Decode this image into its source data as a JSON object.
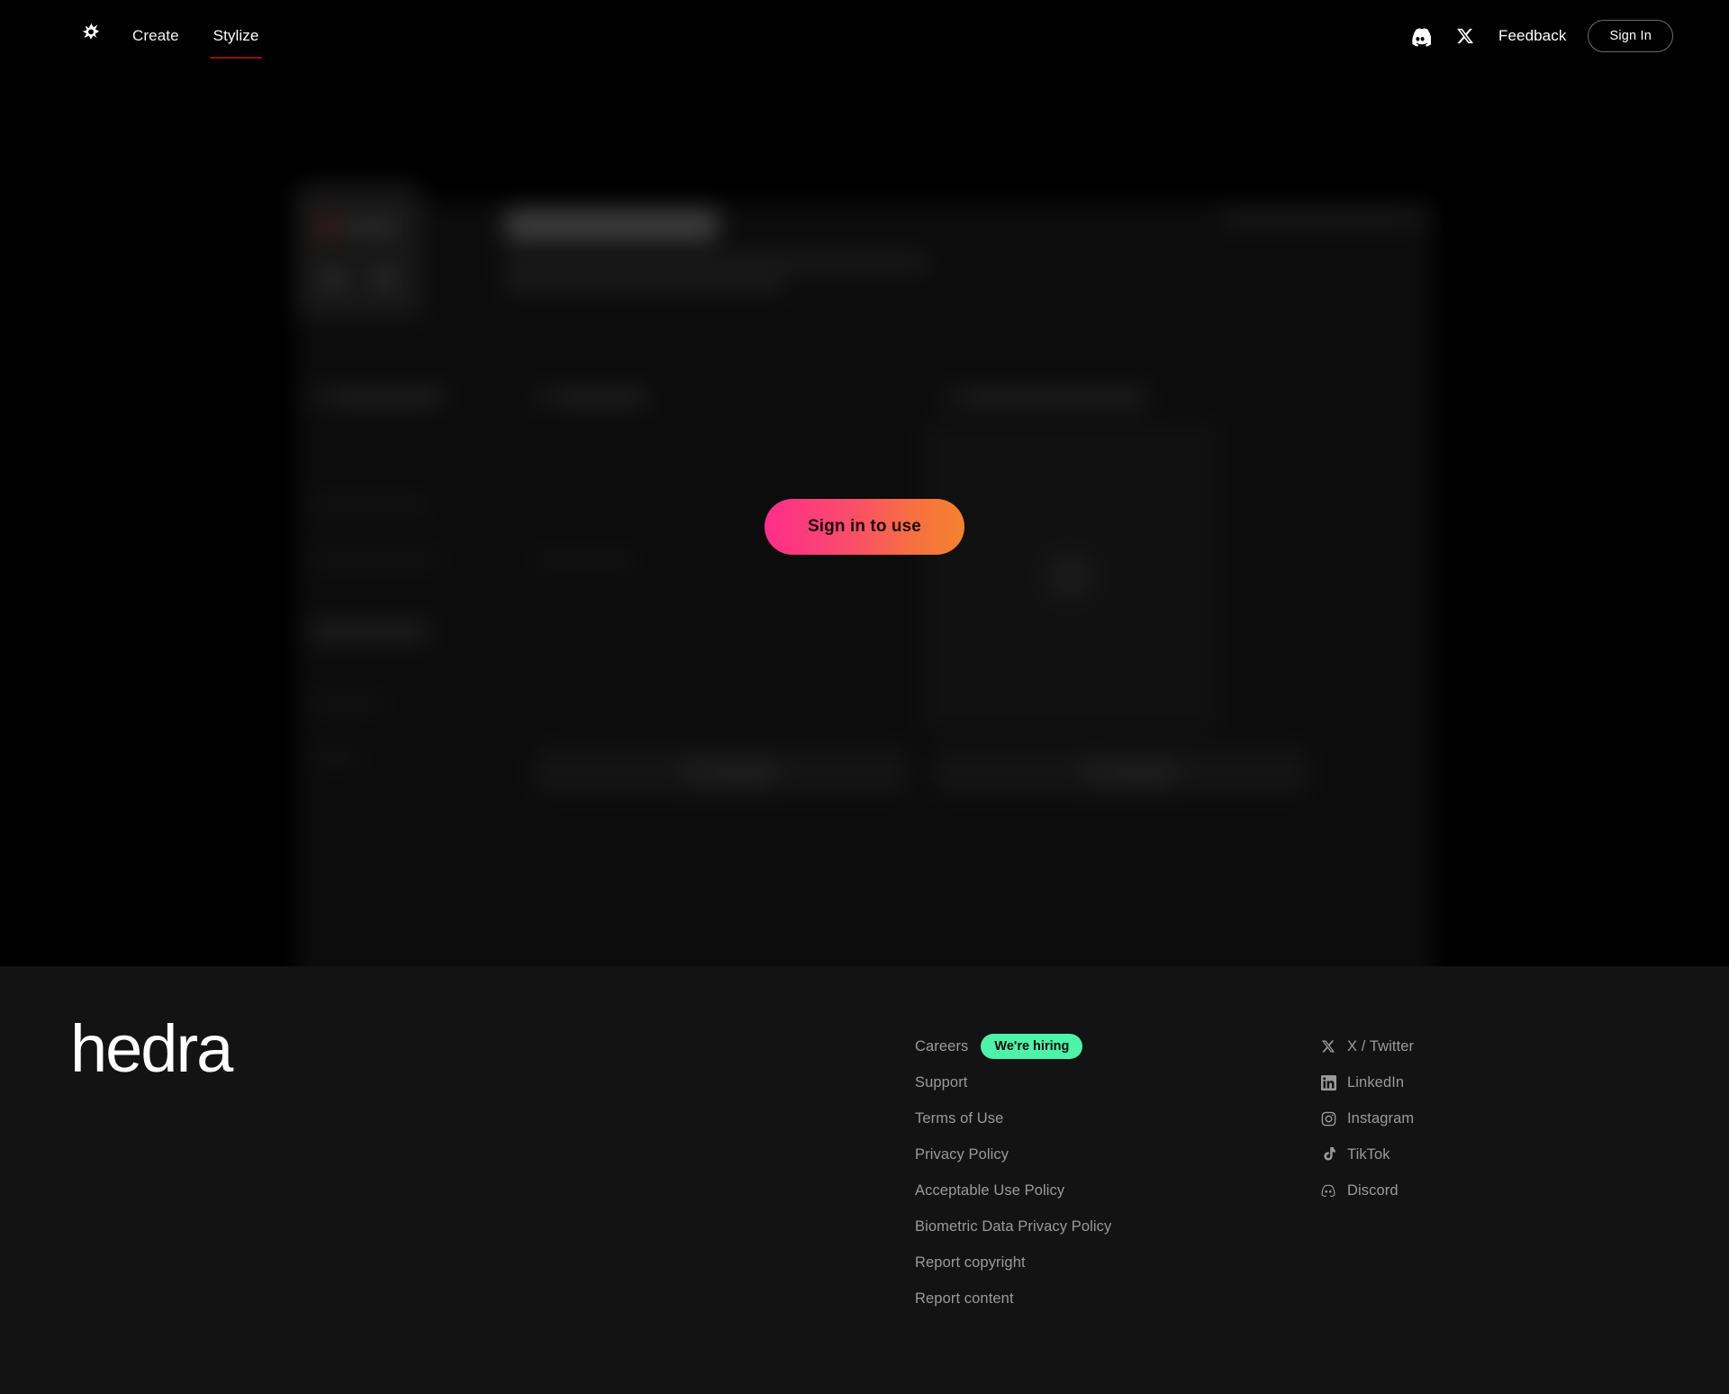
{
  "header": {
    "logo_icon": "hedra-starburst-icon",
    "tabs": [
      {
        "label": "Create",
        "active": false
      },
      {
        "label": "Stylize",
        "active": true
      }
    ],
    "discord_icon": "discord-icon",
    "x_icon": "x-twitter-icon",
    "feedback_label": "Feedback",
    "signin_label": "Sign In",
    "active_tab_underline_color": "#8e1414"
  },
  "main": {
    "state": "locked-blurred",
    "cta_label": "Sign in to use",
    "cta_gradient_from": "#ff2d8a",
    "cta_gradient_to": "#f4812f",
    "panel_background": "#0d0d0d"
  },
  "footer": {
    "wordmark": "hedra",
    "background": "#131313",
    "links": [
      {
        "label": "Careers",
        "badge": "We're hiring"
      },
      {
        "label": "Support",
        "badge": null
      },
      {
        "label": "Terms of Use",
        "badge": null
      },
      {
        "label": "Privacy Policy",
        "badge": null
      },
      {
        "label": "Acceptable Use Policy",
        "badge": null
      },
      {
        "label": "Biometric Data Privacy Policy",
        "badge": null
      },
      {
        "label": "Report copyright",
        "badge": null
      },
      {
        "label": "Report content",
        "badge": null
      }
    ],
    "badge_color": "#4df3a7",
    "social": [
      {
        "label": "X / Twitter",
        "icon": "x-twitter-icon"
      },
      {
        "label": "LinkedIn",
        "icon": "linkedin-icon"
      },
      {
        "label": "Instagram",
        "icon": "instagram-icon"
      },
      {
        "label": "TikTok",
        "icon": "tiktok-icon"
      },
      {
        "label": "Discord",
        "icon": "discord-icon"
      }
    ]
  }
}
